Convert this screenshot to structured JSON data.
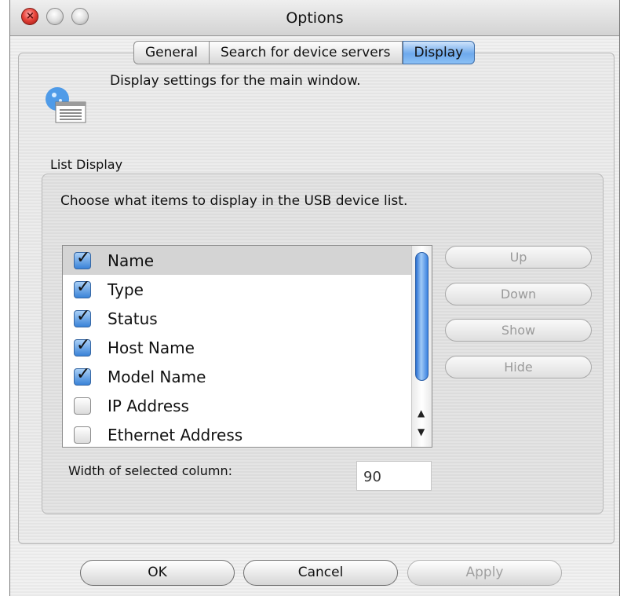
{
  "window": {
    "title": "Options"
  },
  "tabs": [
    {
      "label": "General",
      "active": false
    },
    {
      "label": "Search for device servers",
      "active": false
    },
    {
      "label": "Display",
      "active": true
    }
  ],
  "header": {
    "description": "Display settings for the main window.",
    "icon": "display-settings-icon"
  },
  "list_display": {
    "group_label": "List Display",
    "description": "Choose what items to display in the USB device list.",
    "items": [
      {
        "label": "Name",
        "checked": true,
        "selected": true
      },
      {
        "label": "Type",
        "checked": true,
        "selected": false
      },
      {
        "label": "Status",
        "checked": true,
        "selected": false
      },
      {
        "label": "Host Name",
        "checked": true,
        "selected": false
      },
      {
        "label": "Model Name",
        "checked": true,
        "selected": false
      },
      {
        "label": "IP Address",
        "checked": false,
        "selected": false
      },
      {
        "label": "Ethernet Address",
        "checked": false,
        "selected": false
      }
    ],
    "buttons": {
      "up": "Up",
      "down": "Down",
      "show": "Show",
      "hide": "Hide"
    },
    "width_label": "Width of selected column:",
    "width_value": "90"
  },
  "footer": {
    "ok": "OK",
    "cancel": "Cancel",
    "apply": "Apply"
  },
  "colors": {
    "accent": "#6ea9ec",
    "close": "#e8443a",
    "disabled_text": "#9a9a9a"
  }
}
